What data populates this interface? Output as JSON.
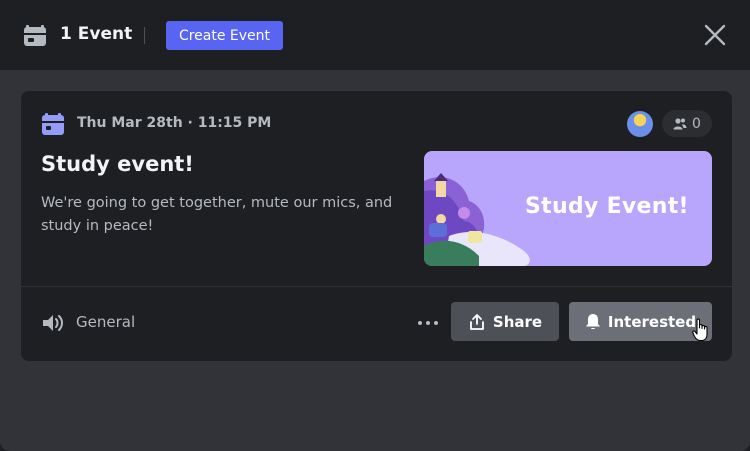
{
  "header": {
    "title": "1 Event",
    "create_label": "Create Event",
    "icons": {
      "calendar": "calendar-icon",
      "close": "close-icon"
    }
  },
  "event": {
    "datetime": "Thu Mar 28th · 11:15 PM",
    "title": "Study event!",
    "description": "We're going to get together, mute our mics, and study in peace!",
    "interested_count": "0",
    "cover_text": "Study Event!",
    "channel": "General"
  },
  "actions": {
    "share_label": "Share",
    "interested_label": "Interested"
  },
  "colors": {
    "accent": "#5865f2",
    "calendar_purple": "#949cf7",
    "cover_bg": "#b7a6fb"
  }
}
